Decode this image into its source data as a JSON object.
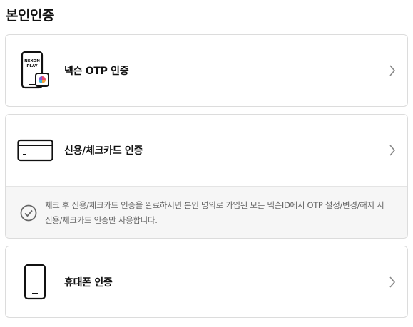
{
  "header": {
    "title": "본인인증"
  },
  "options": {
    "otp": {
      "label": "넥슨 OTP 인증",
      "icon": "phone-otp-icon",
      "icon_text_line1": "NEXON",
      "icon_text_line2": "PLAY"
    },
    "credit_card": {
      "label": "신용/체크카드 인증",
      "icon": "credit-card-icon",
      "notice": "체크 후 신용/체크카드 인증을 완료하시면 본인 명의로 가입된 모든 넥슨ID에서 OTP 설정/변경/해지 시 신용/체크카드 인증만 사용합니다."
    },
    "phone": {
      "label": "휴대폰 인증",
      "icon": "mobile-phone-icon"
    }
  },
  "colors": {
    "border": "#dcdcdc",
    "notice_bg": "#f6f6f6",
    "notice_text": "#666666",
    "chevron": "#888888"
  }
}
